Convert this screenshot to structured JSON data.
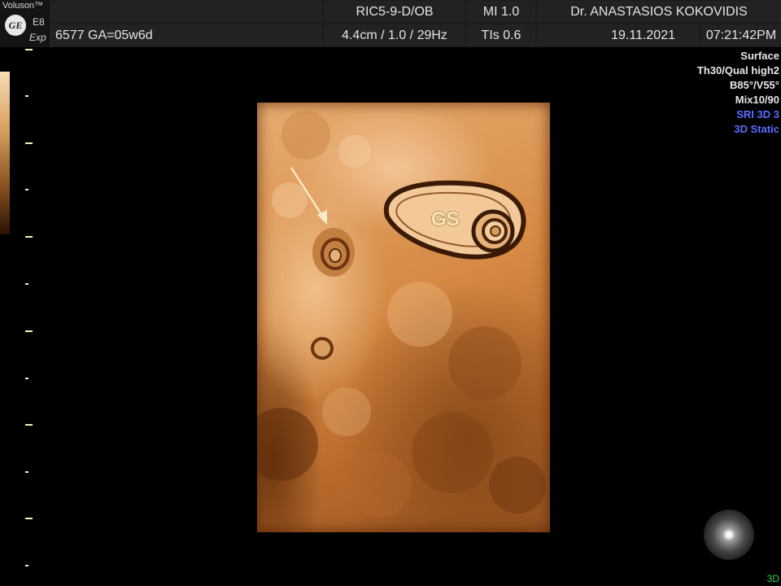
{
  "header": {
    "brand": "Voluson™",
    "logo_text": "GE",
    "model": "E8",
    "model_variant": "Exp",
    "probe": "RIC5-9-D/OB",
    "mi": "MI  1.0",
    "doctor": "Dr. ANASTASIOS KOKOVIDIS",
    "patient": "6577  GA=05w6d",
    "depth": "4.4cm / 1.0 / 29Hz",
    "tis": "TIs  0.6",
    "date": "19.11.2021",
    "time": "07:21:42PM"
  },
  "info_panel": {
    "lines_white": [
      "Surface",
      "Th30/Qual high2",
      "B85°/V55°",
      "Mix10/90"
    ],
    "lines_blue": [
      "SRI 3D 3",
      "3D Static"
    ]
  },
  "image": {
    "annotation": "GS",
    "icons": {
      "arrow": "arrow-annotation-icon",
      "light": "light-source-icon"
    }
  },
  "status": {
    "mode": "3D"
  },
  "colors": {
    "header_bg": "#1b1b1b",
    "accent_blue": "#5a6cff",
    "mode_green": "#34d04a",
    "render_tone": "#d68a45"
  }
}
